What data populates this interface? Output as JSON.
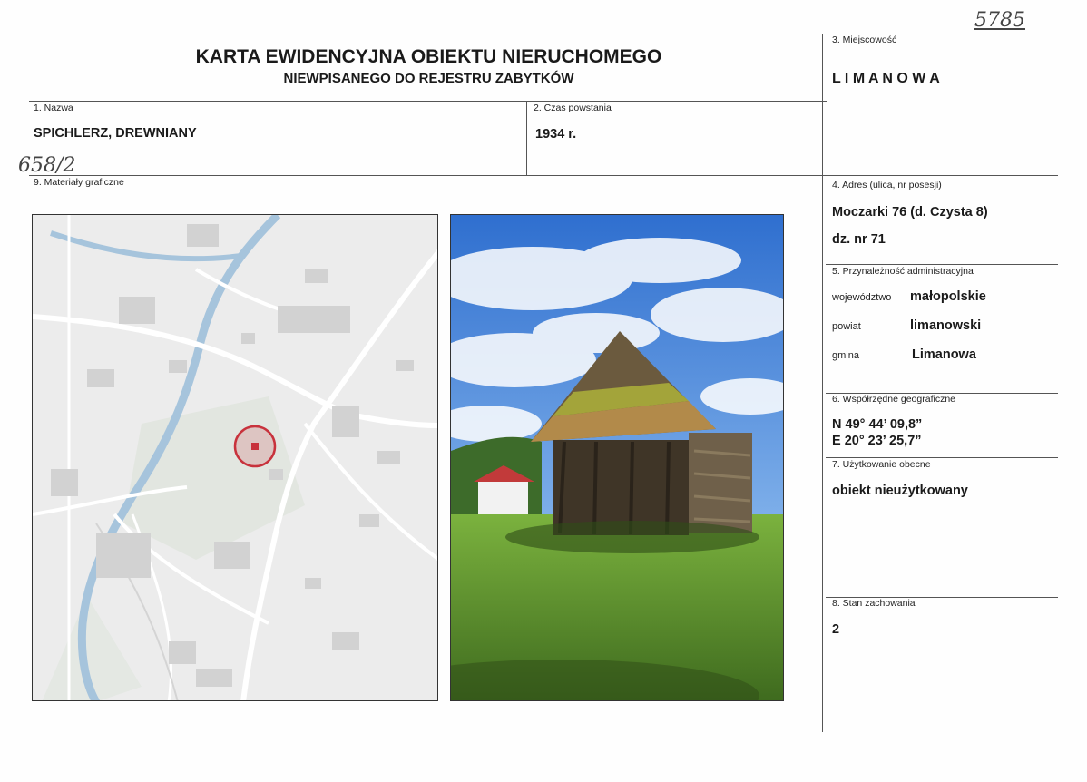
{
  "archive_number": "5785",
  "annotation": "658/2",
  "title": {
    "main": "KARTA EWIDENCYJNA OBIEKTU NIERUCHOMEGO",
    "sub": "NIEWPISANEGO DO REJESTRU ZABYTKÓW"
  },
  "fields": {
    "nazwa": {
      "label": "1. Nazwa",
      "value": "SPICHLERZ, DREWNIANY"
    },
    "czas": {
      "label": "2. Czas powstania",
      "value": "1934 r."
    },
    "miejscowosc": {
      "label": "3. Miejscowość",
      "value": "L I M A N O W A"
    },
    "adres": {
      "label": "4. Adres (ulica, nr posesji)",
      "line1": "Moczarki 76 (d. Czysta 8)",
      "line2": "dz. nr 71"
    },
    "przynaleznosc": {
      "label": "5. Przynależność administracyjna",
      "rows": [
        {
          "key": "województwo",
          "value": "małopolskie"
        },
        {
          "key": "powiat",
          "value": "limanowski"
        },
        {
          "key": "gmina",
          "value": "Limanowa"
        }
      ]
    },
    "wspolrzedne": {
      "label": "6. Współrzędne geograficzne",
      "lat": "N 49° 44’ 09,8”",
      "lon": "E 20° 23’ 25,7”"
    },
    "uzytkowanie": {
      "label": "7. Użytkowanie obecne",
      "value": "obiekt nieużytkowany"
    },
    "stan": {
      "label": "8. Stan zachowania",
      "value": "2"
    },
    "materialy": {
      "label": "9. Materiały graficzne"
    }
  },
  "colors": {
    "marker": "#c8323c",
    "river": "#9bbdd6",
    "sky": "#4a86d4",
    "grass": "#6fa83a"
  },
  "icons": [
    "location-marker-icon"
  ]
}
